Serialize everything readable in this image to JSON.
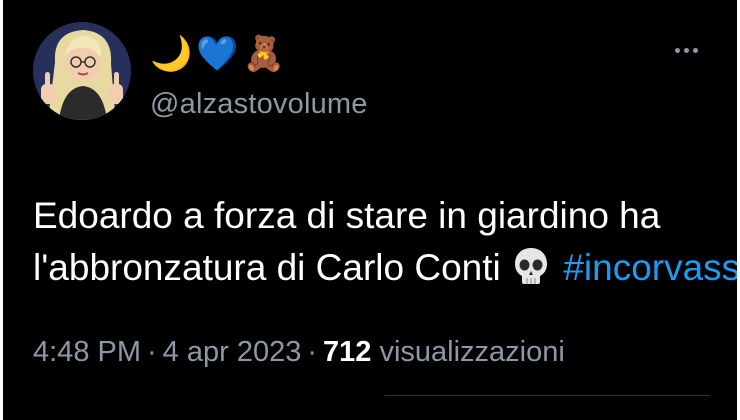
{
  "user": {
    "display_name_emojis": [
      "🌙",
      "💙",
      "🧸"
    ],
    "handle": "@alzastovolume"
  },
  "tweet": {
    "text_line1": "Edoardo a forza di stare in giardino ha",
    "text_line2": "l'abbronzatura di Carlo Conti",
    "emoji": "💀",
    "hashtag": "#incorvassi"
  },
  "meta": {
    "time": "4:48 PM",
    "separator": "·",
    "date": "4 apr 2023",
    "views_count": "712",
    "views_label": "visualizzazioni"
  },
  "colors": {
    "background": "#000000",
    "text": "#ffffff",
    "secondary": "#8b98a5",
    "link": "#1d9bf0"
  }
}
